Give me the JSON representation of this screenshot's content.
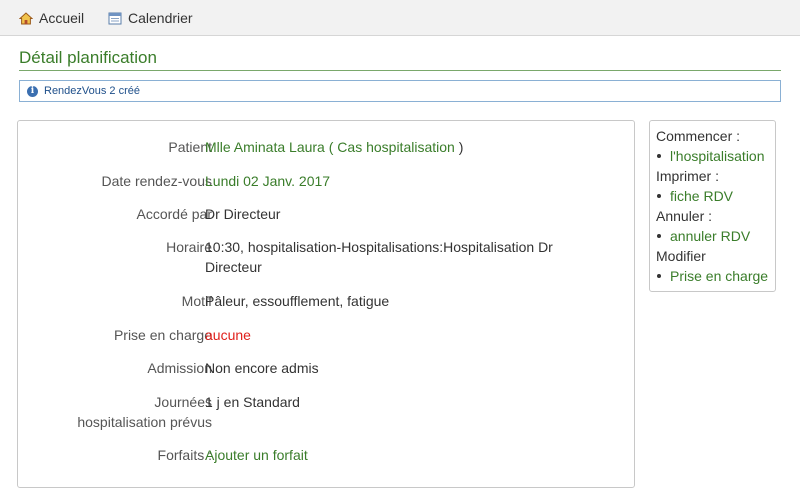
{
  "nav": {
    "home_label": "Accueil",
    "calendar_label": "Calendrier"
  },
  "page": {
    "title": "Détail planification"
  },
  "notice": {
    "message": "RendezVous 2 créé"
  },
  "detail": {
    "patient_label": "Patient",
    "patient_name": "Mlle Aminata Laura",
    "patient_open": "(",
    "patient_case": "Cas hospitalisation",
    "patient_close": ")",
    "date_label": "Date rendez-vous",
    "date_value": "Lundi 02 Janv. 2017",
    "granted_label": "Accordé par",
    "granted_value": "Dr Directeur",
    "schedule_label": "Horaire",
    "schedule_value": "10:30, hospitalisation-Hospitalisations:Hospitalisation Dr Directeur",
    "reason_label": "Motif",
    "reason_value": "Pâleur, essoufflement, fatigue",
    "coverage_label": "Prise en charge",
    "coverage_value": "aucune",
    "admission_label": "Admission",
    "admission_value": "Non encore admis",
    "days_label": "Journées hospitalisation prévus",
    "days_value": "1 j en Standard",
    "packages_label": "Forfaits :",
    "packages_value": "Ajouter un forfait"
  },
  "sidebar": {
    "start_heading": "Commencer :",
    "start_link": "l'hospitalisation",
    "print_heading": "Imprimer :",
    "print_link": "fiche RDV",
    "cancel_heading": "Annuler :",
    "cancel_link": "annuler RDV",
    "edit_heading": "Modifier",
    "edit_link": "Prise en charge"
  },
  "colors": {
    "accent_green": "#3a7d2a",
    "alert_red": "#e0201c",
    "info_blue": "#3b6fb0"
  }
}
